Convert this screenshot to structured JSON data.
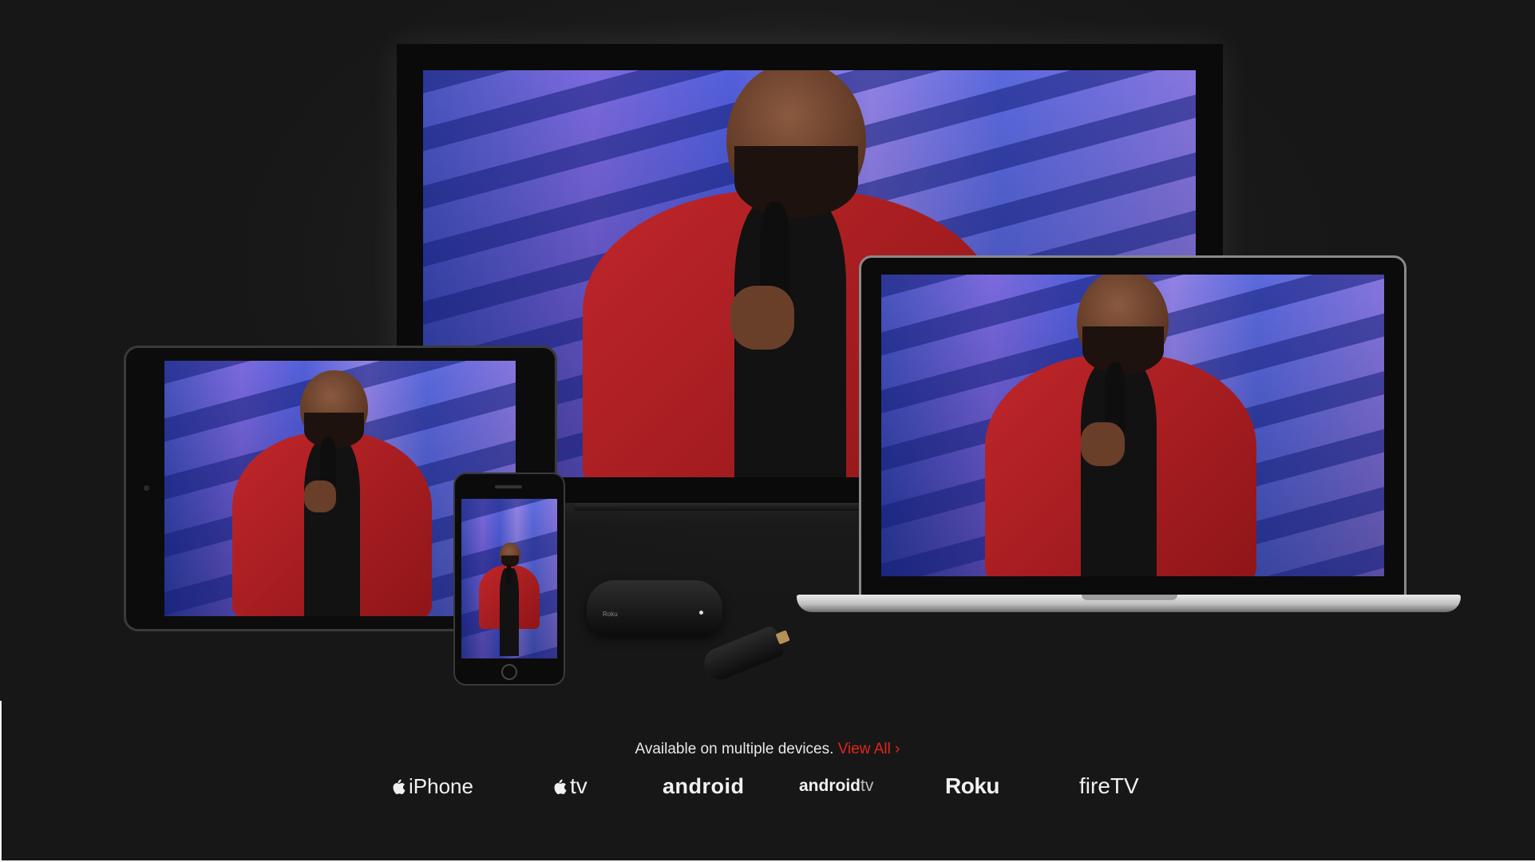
{
  "hero": {
    "devices": [
      "tv",
      "tablet",
      "phone",
      "laptop",
      "streaming-box",
      "chromecast-dongle"
    ],
    "roku_box_label": "Roku"
  },
  "availability": {
    "text": "Available on multiple devices.",
    "link_label": "View All ›",
    "link_color": "#e2261c"
  },
  "platforms": {
    "iphone": "iPhone",
    "appletv": "tv",
    "android": "android",
    "androidtv_main": "android",
    "androidtv_suffix": "tv",
    "roku": "Roku",
    "firetv": "fireTV"
  },
  "colors": {
    "background": "#171717",
    "text": "#e8e8e8",
    "jacket": "#c0262a",
    "stage_backdrop": "#6c5ad6"
  }
}
